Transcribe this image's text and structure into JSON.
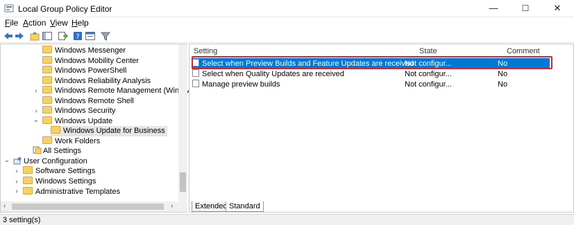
{
  "window": {
    "title": "Local Group Policy Editor",
    "minimize": "—",
    "maximize": "☐",
    "close": "✕"
  },
  "menu": [
    "File",
    "Action",
    "View",
    "Help"
  ],
  "menu_underline": [
    "F",
    "A",
    "V",
    "H"
  ],
  "tree": {
    "items": [
      {
        "label": "Windows Messenger"
      },
      {
        "label": "Windows Mobility Center"
      },
      {
        "label": "Windows PowerShell"
      },
      {
        "label": "Windows Reliability Analysis"
      },
      {
        "label": "Windows Remote Management (WinRM)"
      },
      {
        "label": "Windows Remote Shell"
      },
      {
        "label": "Windows Security"
      },
      {
        "label": "Windows Update"
      },
      {
        "label": "Windows Update for Business"
      },
      {
        "label": "Work Folders"
      },
      {
        "label": "All Settings"
      },
      {
        "label": "User Configuration"
      },
      {
        "label": "Software Settings"
      },
      {
        "label": "Windows Settings"
      },
      {
        "label": "Administrative Templates"
      }
    ]
  },
  "list": {
    "headers": {
      "setting": "Setting",
      "state": "State",
      "comment": "Comment"
    },
    "rows": [
      {
        "setting": "Select when Preview Builds and Feature Updates are received",
        "state": "Not configur...",
        "comment": "No"
      },
      {
        "setting": "Select when Quality Updates are received",
        "state": "Not configur...",
        "comment": "No"
      },
      {
        "setting": "Manage preview builds",
        "state": "Not configur...",
        "comment": "No"
      }
    ]
  },
  "tabs": {
    "extended": "Extended",
    "standard": "Standard"
  },
  "status": "3 setting(s)",
  "colors": {
    "selection": "#0078d7",
    "highlight_box": "#d9232e",
    "folder": "#f5d06b"
  }
}
